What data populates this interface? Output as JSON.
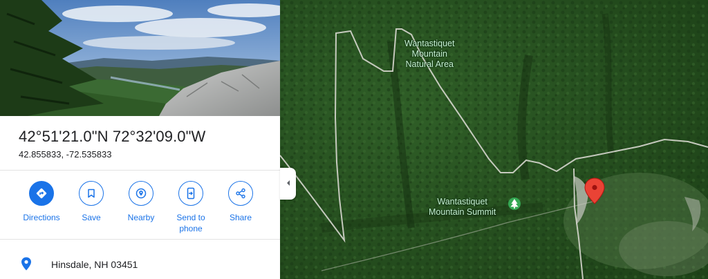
{
  "place": {
    "coordinates_dms": "42°51'21.0\"N 72°32'09.0\"W",
    "coordinates_decimal": "42.855833, -72.535833"
  },
  "actions": [
    {
      "label": "Directions",
      "icon": "directions-icon"
    },
    {
      "label": "Save",
      "icon": "bookmark-icon"
    },
    {
      "label": "Nearby",
      "icon": "nearby-icon"
    },
    {
      "label": "Send to\nphone",
      "icon": "send-to-phone-icon"
    },
    {
      "label": "Share",
      "icon": "share-icon"
    }
  ],
  "address": {
    "text": "Hinsdale, NH 03451",
    "icon": "location-pin-icon"
  },
  "map": {
    "view": "satellite",
    "labels": {
      "natural_area": "Wantastiquet\nMountain\nNatural Area",
      "summit": "Wantastiquet\nMountain Summit"
    },
    "marker_color": "#ea4335",
    "summit_icon_color": "#34a853"
  },
  "colors": {
    "accent": "#1a73e8",
    "map_label_text": "#c6f0d2",
    "trail_line": "#d7d7cf"
  }
}
